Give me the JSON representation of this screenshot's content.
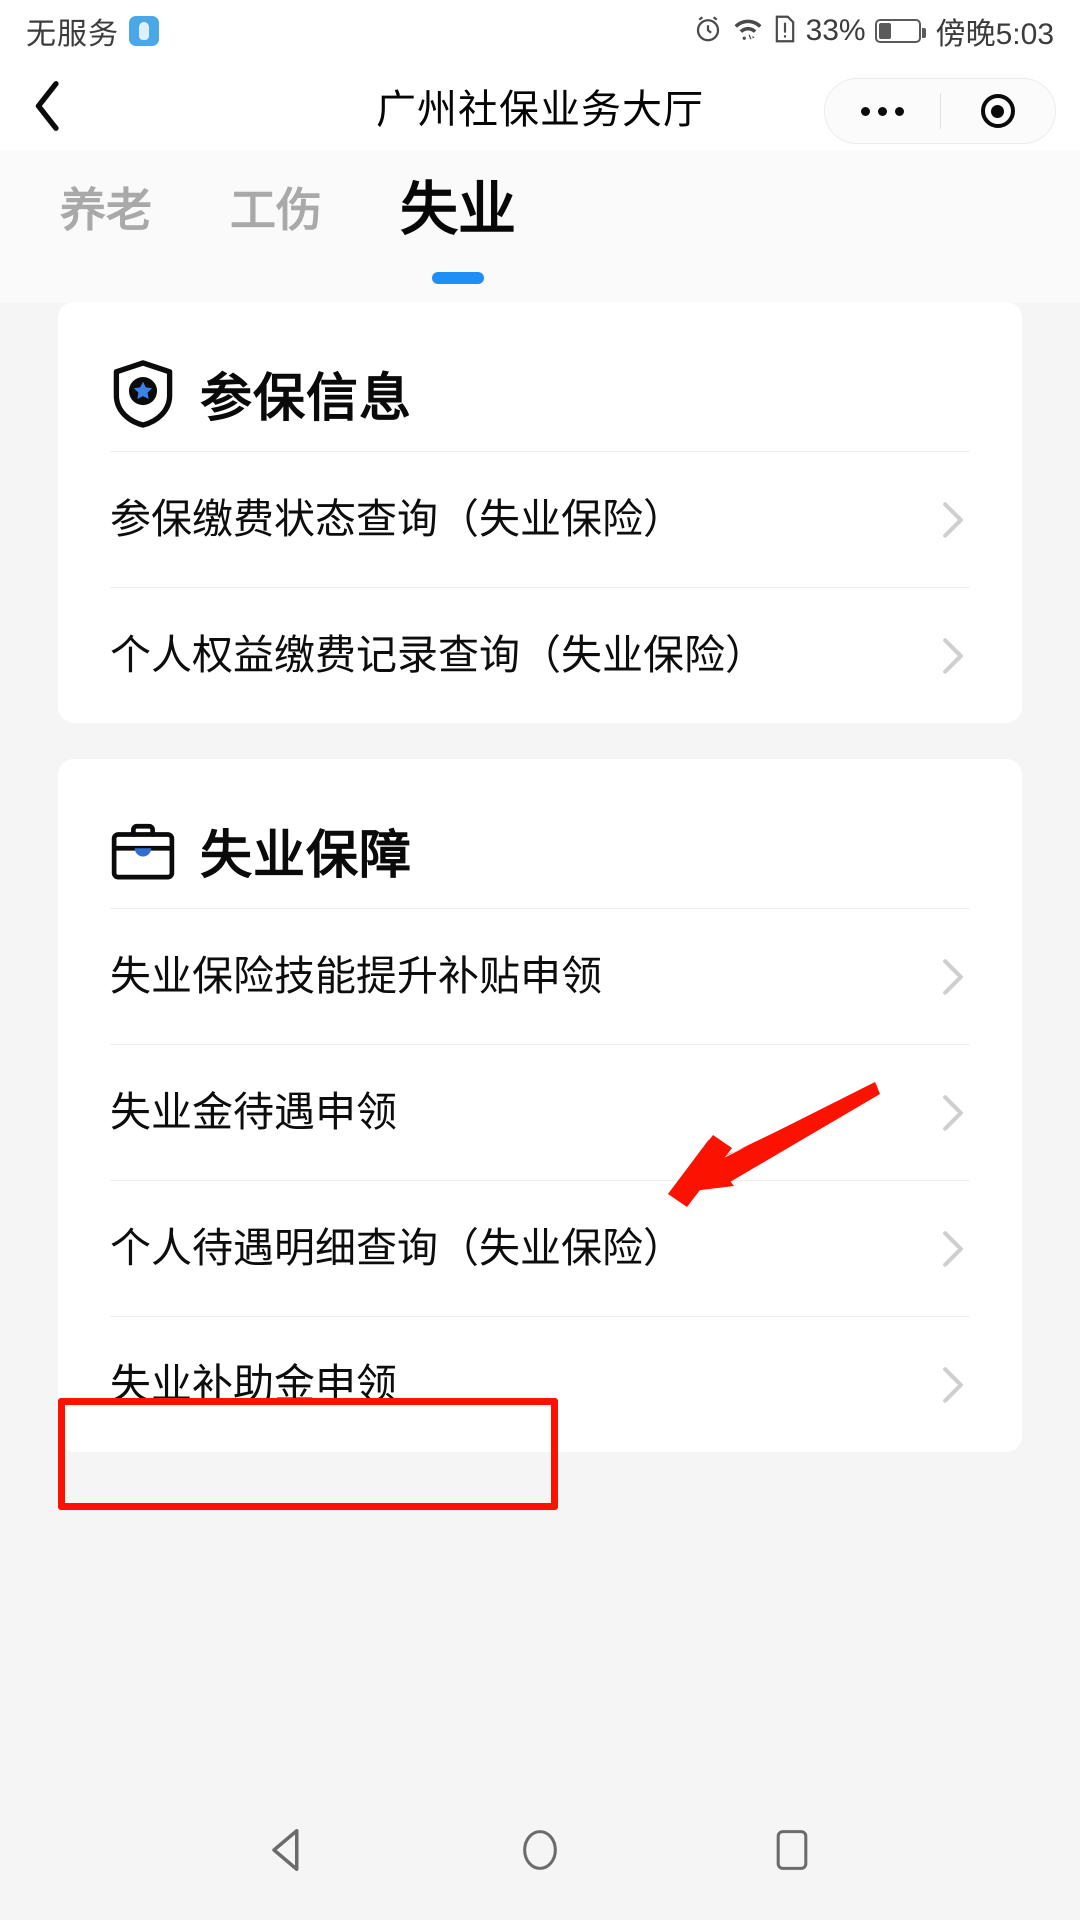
{
  "status_bar": {
    "carrier": "无服务",
    "battery_percent": "33%",
    "time": "傍晚5:03",
    "icons": [
      "wechat-badge-icon",
      "alarm-icon",
      "wifi-icon",
      "sim-warning-icon",
      "battery-icon"
    ]
  },
  "navbar": {
    "title": "广州社保业务大厅",
    "back_icon": "chevron-left-icon",
    "more_icon": "more-dots-icon",
    "close_icon": "target-circle-icon"
  },
  "tabs": [
    {
      "label": "养老",
      "active": false
    },
    {
      "label": "工伤",
      "active": false
    },
    {
      "label": "失业",
      "active": true
    }
  ],
  "cards": [
    {
      "title": "参保信息",
      "icon": "shield-star-icon",
      "rows": [
        {
          "label": "参保缴费状态查询（失业保险）",
          "chevron": "chevron-right-icon",
          "highlighted": false
        },
        {
          "label": "个人权益缴费记录查询（失业保险）",
          "chevron": "chevron-right-icon",
          "highlighted": false
        }
      ]
    },
    {
      "title": "失业保障",
      "icon": "briefcase-icon",
      "rows": [
        {
          "label": "失业保险技能提升补贴申领",
          "chevron": "chevron-right-icon",
          "highlighted": false
        },
        {
          "label": "失业金待遇申领",
          "chevron": "chevron-right-icon",
          "highlighted": true
        },
        {
          "label": "个人待遇明细查询（失业保险）",
          "chevron": "chevron-right-icon",
          "highlighted": false
        },
        {
          "label": "失业补助金申领",
          "chevron": "chevron-right-icon",
          "highlighted": false
        }
      ]
    }
  ],
  "annotation": {
    "highlight_color": "#fb1200",
    "arrow_icon": "red-arrow-icon",
    "target_row_label": "失业金待遇申领"
  },
  "system_nav": {
    "back": "triangle-back-icon",
    "home": "circle-home-icon",
    "recents": "square-recents-icon"
  },
  "theme": {
    "accent": "#1e8ff5",
    "page_bg": "#f5f5f5",
    "card_bg": "#ffffff",
    "text": "#0d0d0d",
    "muted": "#a9a9a9"
  }
}
